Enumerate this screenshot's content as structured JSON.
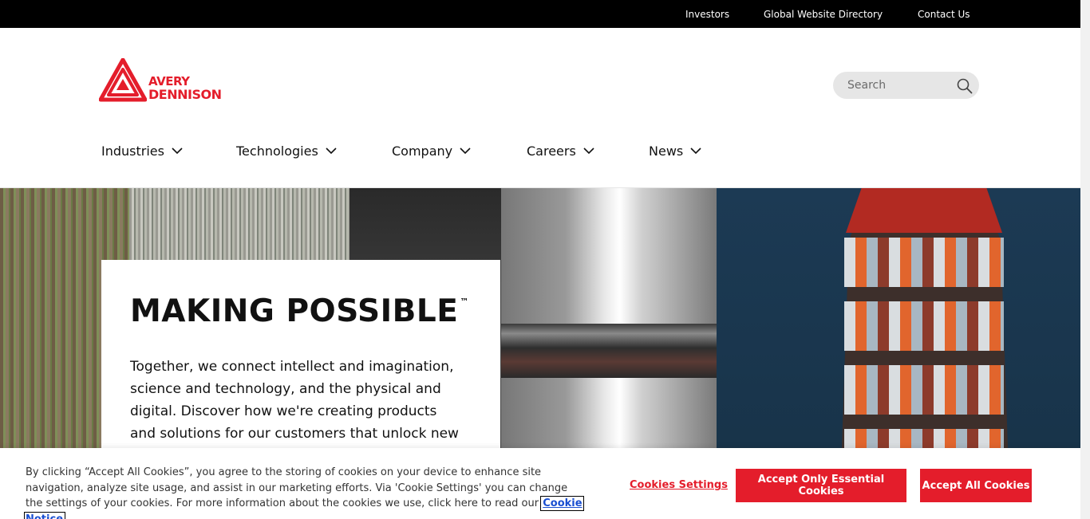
{
  "utility_nav": {
    "investors": "Investors",
    "directory": "Global Website Directory",
    "contact": "Contact Us"
  },
  "logo": {
    "line1": "AVERY",
    "line2": "DENNISON",
    "icon": "avery-dennison-triangle-logo",
    "color": "#e41d2b"
  },
  "search": {
    "placeholder": "Search",
    "value": "",
    "icon": "search-icon"
  },
  "main_nav": [
    {
      "label": "Industries",
      "icon": "chevron-down-icon"
    },
    {
      "label": "Technologies",
      "icon": "chevron-down-icon"
    },
    {
      "label": "Company",
      "icon": "chevron-down-icon"
    },
    {
      "label": "Careers",
      "icon": "chevron-down-icon"
    },
    {
      "label": "News",
      "icon": "chevron-down-icon"
    }
  ],
  "hero": {
    "title": "MAKING POSSIBLE",
    "trademark": "™",
    "body": "Together, we connect intellect and imagination, science and technology, and the physical and digital. Discover how we're creating products and solutions for our customers that unlock new value"
  },
  "cookie_banner": {
    "text": "By clicking “Accept All Cookies”, you agree to the storing of cookies on your device to enhance site navigation, analyze site usage, and assist in our marketing efforts. Via 'Cookie Settings' you can change the settings of your cookies. For more information about the cookies we use, click here to read our",
    "notice_link": "Cookie Notice",
    "settings_label": "Cookies Settings",
    "essential_label": "Accept Only Essential Cookies",
    "accept_all_label": "Accept All Cookies"
  },
  "colors": {
    "brand_red": "#e41d2b",
    "utility_bar": "#000000",
    "search_bg": "#e6e6e6"
  }
}
